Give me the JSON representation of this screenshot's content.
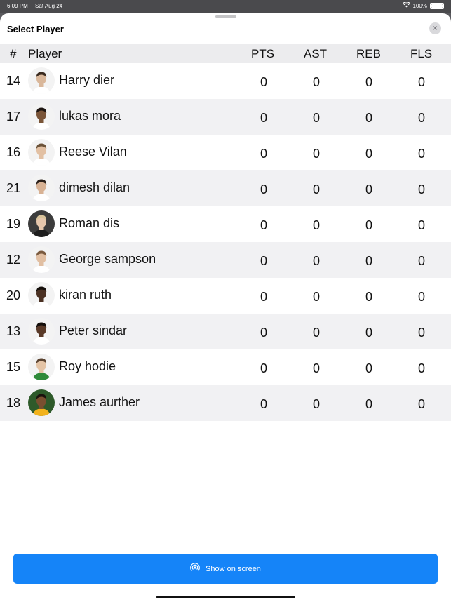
{
  "status": {
    "time": "6:09 PM",
    "date": "Sat Aug 24",
    "battery": "100%"
  },
  "sheet": {
    "title": "Select Player",
    "close_icon": "×"
  },
  "table": {
    "headers": {
      "num": "#",
      "player": "Player",
      "pts": "PTS",
      "ast": "AST",
      "reb": "REB",
      "fls": "FLS"
    },
    "rows": [
      {
        "num": "14",
        "name": "Harry dier",
        "pts": "0",
        "ast": "0",
        "reb": "0",
        "fls": "0",
        "skin": "#d9b79a",
        "hair": "#3a2a1e",
        "shirt": "#ffffff",
        "bg": "#f3f3f3"
      },
      {
        "num": "17",
        "name": "lukas mora",
        "pts": "0",
        "ast": "0",
        "reb": "0",
        "fls": "0",
        "skin": "#7a5538",
        "hair": "#1d1511",
        "shirt": "#ffffff",
        "bg": "#f3f3f3"
      },
      {
        "num": "16",
        "name": "Reese Vilan",
        "pts": "0",
        "ast": "0",
        "reb": "0",
        "fls": "0",
        "skin": "#e2c0a3",
        "hair": "#6b5238",
        "shirt": "#ffffff",
        "bg": "#f3f3f3"
      },
      {
        "num": "21",
        "name": "dimesh dilan",
        "pts": "0",
        "ast": "0",
        "reb": "0",
        "fls": "0",
        "skin": "#d8b294",
        "hair": "#2b201a",
        "shirt": "#ffffff",
        "bg": "#f3f3f3"
      },
      {
        "num": "19",
        "name": "Roman dis",
        "pts": "0",
        "ast": "0",
        "reb": "0",
        "fls": "0",
        "skin": "#e6c7ac",
        "hair": "#d8c39a",
        "shirt": "#1e1e1e",
        "bg": "#3c3c3c"
      },
      {
        "num": "12",
        "name": "George sampson",
        "pts": "0",
        "ast": "0",
        "reb": "0",
        "fls": "0",
        "skin": "#e1bfa2",
        "hair": "#7a5a3e",
        "shirt": "#ffffff",
        "bg": "#f3f3f3"
      },
      {
        "num": "20",
        "name": "kiran ruth",
        "pts": "0",
        "ast": "0",
        "reb": "0",
        "fls": "0",
        "skin": "#4a3022",
        "hair": "#140e0a",
        "shirt": "#ffffff",
        "bg": "#f3f3f3"
      },
      {
        "num": "13",
        "name": "Peter sindar",
        "pts": "0",
        "ast": "0",
        "reb": "0",
        "fls": "0",
        "skin": "#5a3a28",
        "hair": "#150f0b",
        "shirt": "#ffffff",
        "bg": "#f3f3f3"
      },
      {
        "num": "15",
        "name": "Roy hodie",
        "pts": "0",
        "ast": "0",
        "reb": "0",
        "fls": "0",
        "skin": "#e4c4a6",
        "hair": "#5a4330",
        "shirt": "#2f8a3a",
        "bg": "#f3f3f3"
      },
      {
        "num": "18",
        "name": "James aurther",
        "pts": "0",
        "ast": "0",
        "reb": "0",
        "fls": "0",
        "skin": "#7a4f30",
        "hair": "#1a120d",
        "shirt": "#f2b21c",
        "bg": "#2e5a2a"
      }
    ]
  },
  "footer": {
    "button_label": "Show on screen",
    "button_icon": "broadcast-icon"
  },
  "colors": {
    "accent": "#1584f8",
    "header_bg": "#ececee",
    "row_alt": "#f1f1f3"
  }
}
